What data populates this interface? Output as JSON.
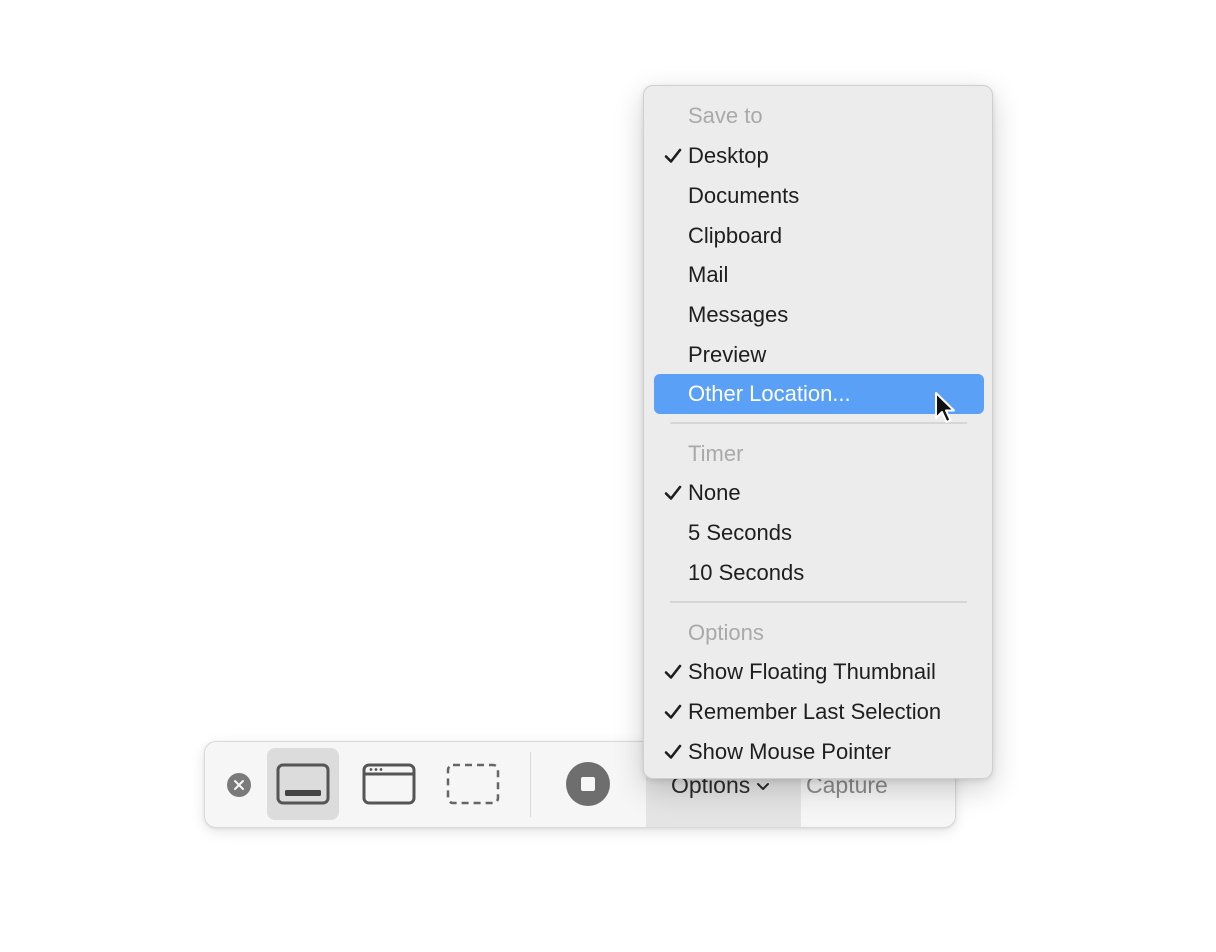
{
  "toolbar": {
    "options_label": "Options",
    "capture_label": "Capture"
  },
  "menu": {
    "save_to": {
      "header": "Save to",
      "items": [
        {
          "label": "Desktop",
          "checked": true
        },
        {
          "label": "Documents",
          "checked": false
        },
        {
          "label": "Clipboard",
          "checked": false
        },
        {
          "label": "Mail",
          "checked": false
        },
        {
          "label": "Messages",
          "checked": false
        },
        {
          "label": "Preview",
          "checked": false
        },
        {
          "label": "Other Location...",
          "checked": false,
          "highlighted": true
        }
      ]
    },
    "timer": {
      "header": "Timer",
      "items": [
        {
          "label": "None",
          "checked": true
        },
        {
          "label": "5 Seconds",
          "checked": false
        },
        {
          "label": "10 Seconds",
          "checked": false
        }
      ]
    },
    "options": {
      "header": "Options",
      "items": [
        {
          "label": "Show Floating Thumbnail",
          "checked": true
        },
        {
          "label": "Remember Last Selection",
          "checked": true
        },
        {
          "label": "Show Mouse Pointer",
          "checked": true
        }
      ]
    }
  },
  "colors": {
    "highlight": "#5aa0f7",
    "menu_bg": "#ececec",
    "header_text": "#a9a9a9"
  },
  "icons": {
    "close": "close-icon",
    "capture_screen": "capture-entire-screen-icon",
    "capture_window": "capture-window-icon",
    "capture_selection": "capture-selection-icon",
    "record": "record-icon",
    "chevron": "chevron-down-icon",
    "checkmark": "checkmark-icon",
    "pointer": "mouse-pointer-icon"
  }
}
